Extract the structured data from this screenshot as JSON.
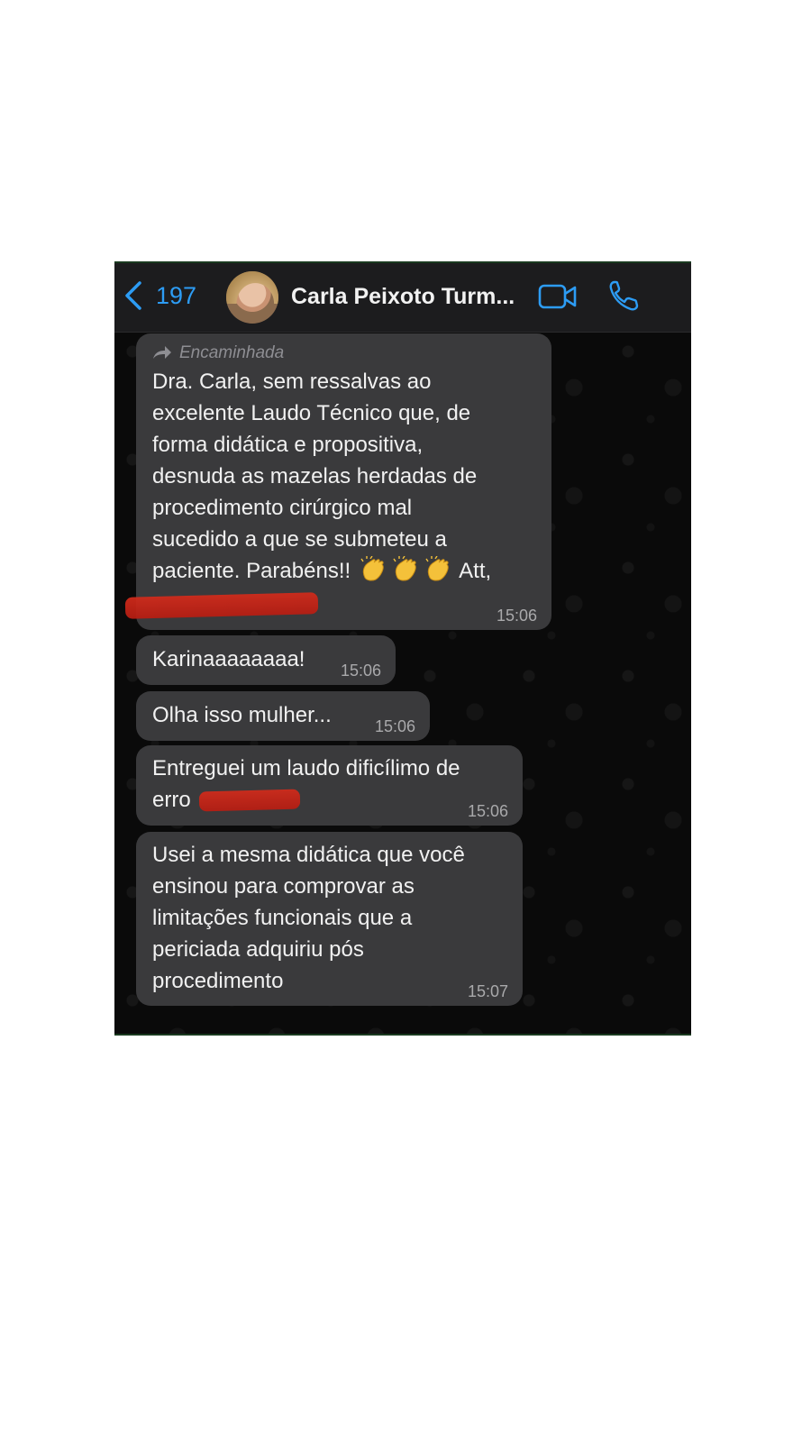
{
  "header": {
    "back_count": "197",
    "title": "Carla Peixoto Turm..."
  },
  "icons": {
    "back": "chevron-left-icon",
    "video": "video-camera-icon",
    "phone": "phone-icon",
    "forward": "forward-arrow-icon",
    "emoji": "clapping-hands-emoji"
  },
  "colors": {
    "accent": "#2d9cf4",
    "bubble": "#3a3a3c",
    "background": "#0b0b0b",
    "redaction": "#c8231a"
  },
  "messages": [
    {
      "forwarded_label": "Encaminhada",
      "text_main": "Dra. Carla, sem ressalvas ao\nexcelente Laudo Técnico que, de\nforma didática e propositiva,\ndesnuda as mazelas herdadas de\nprocedimento cirúrgico mal\nsucedido a que se submeteu a\npaciente. Parabéns!!",
      "text_after_emoji": "Att,",
      "time": "15:06"
    },
    {
      "text": "Karinaaaaaaaa!",
      "time": "15:06"
    },
    {
      "text": "Olha isso mulher...",
      "time": "15:06"
    },
    {
      "text": "Entreguei um laudo dificílimo de\nerro",
      "time": "15:06"
    },
    {
      "text": "Usei a mesma didática que você\nensinou para comprovar as\nlimitações funcionais que a\npericiada adquiriu pós\nprocedimento",
      "time": "15:07"
    }
  ]
}
